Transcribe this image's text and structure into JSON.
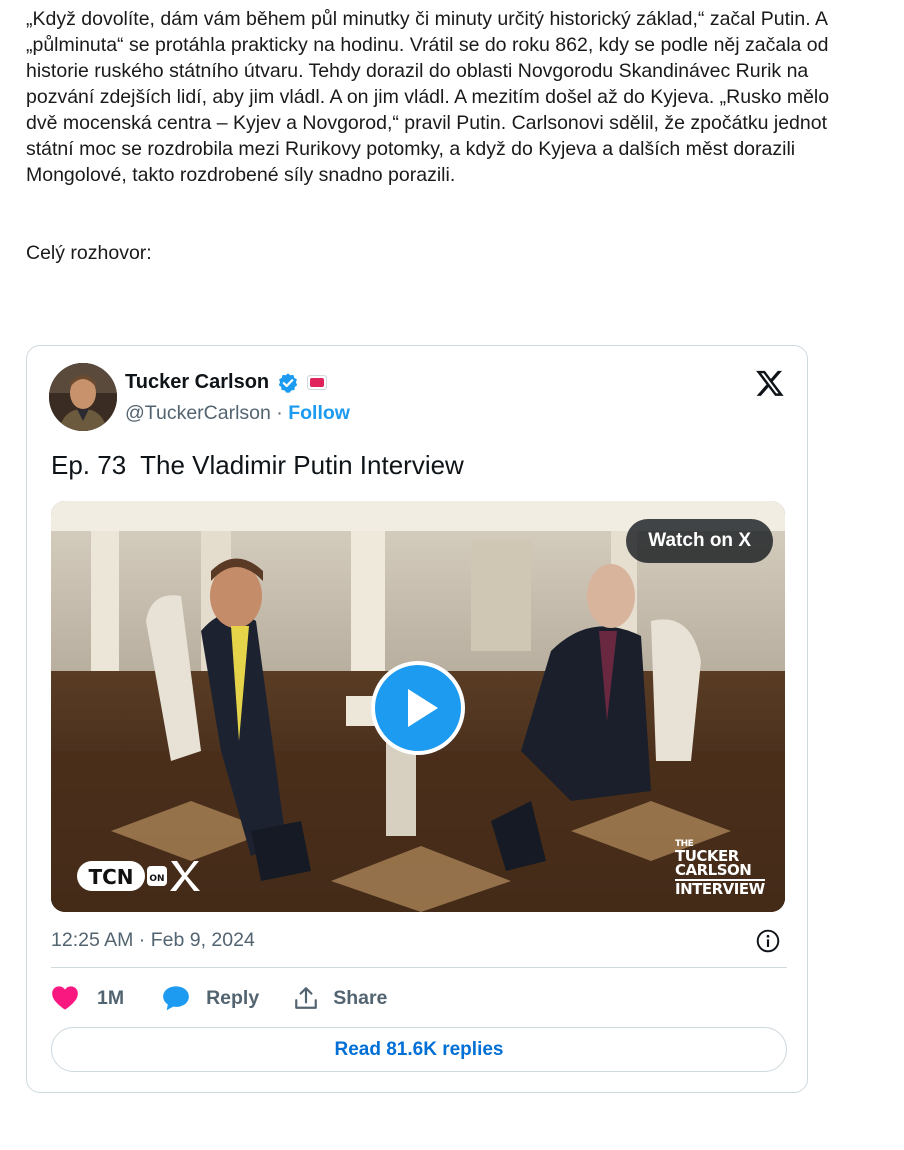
{
  "article": {
    "lines": [
      "„Když dovolíte, dám vám během půl minutky či minuty určitý historický základ,“ začal Putin. A",
      "„půlminuta“ se protáhla prakticky na hodinu. Vrátil se do roku 862, kdy se podle něj začala od",
      "historie ruského státního útvaru. Tehdy dorazil do oblasti Novgorodu Skandinávec Rurik na",
      "pozvání zdejších lidí, aby jim vládl. A on jim vládl. A mezitím došel až do Kyjeva. „Rusko mělo",
      "dvě mocenská centra – Kyjev a Novgorod,“ pravil Putin. Carlsonovi sdělil, že zpočátku jednot",
      "státní moc se rozdrobila mezi Rurikovy potomky, a když do Kyjeva a dalších měst dorazili",
      "Mongolové, takto rozdrobené síly snadno porazili."
    ],
    "interview_lead": "Celý rozhovor:"
  },
  "tweet": {
    "author_name": "Tucker Carlson",
    "handle": "@TuckerCarlson",
    "separator": " · ",
    "follow_label": "Follow",
    "text": "Ep. 73  The Vladimir Putin Interview",
    "watch_label": "Watch on X",
    "tcn_label": "TCN",
    "tcn_on": "ON",
    "show_logo": {
      "line1": "THE",
      "line2": "TUCKER",
      "line3": "CARLSON",
      "line4": "INTERVIEW"
    },
    "timestamp": "12:25 AM · Feb 9, 2024",
    "likes": "1M",
    "reply_label": "Reply",
    "share_label": "Share",
    "read_replies_label": "Read 81.6K replies",
    "icons": {
      "verified": "verified-badge-icon",
      "x": "x-logo-icon",
      "info": "info-icon",
      "like": "heart-icon",
      "reply": "speech-bubble-icon",
      "share": "share-upload-icon",
      "play": "play-icon"
    },
    "colors": {
      "accent": "#1d9bf0",
      "like": "#f91880",
      "link": "#006fd6",
      "muted": "#536471"
    }
  }
}
